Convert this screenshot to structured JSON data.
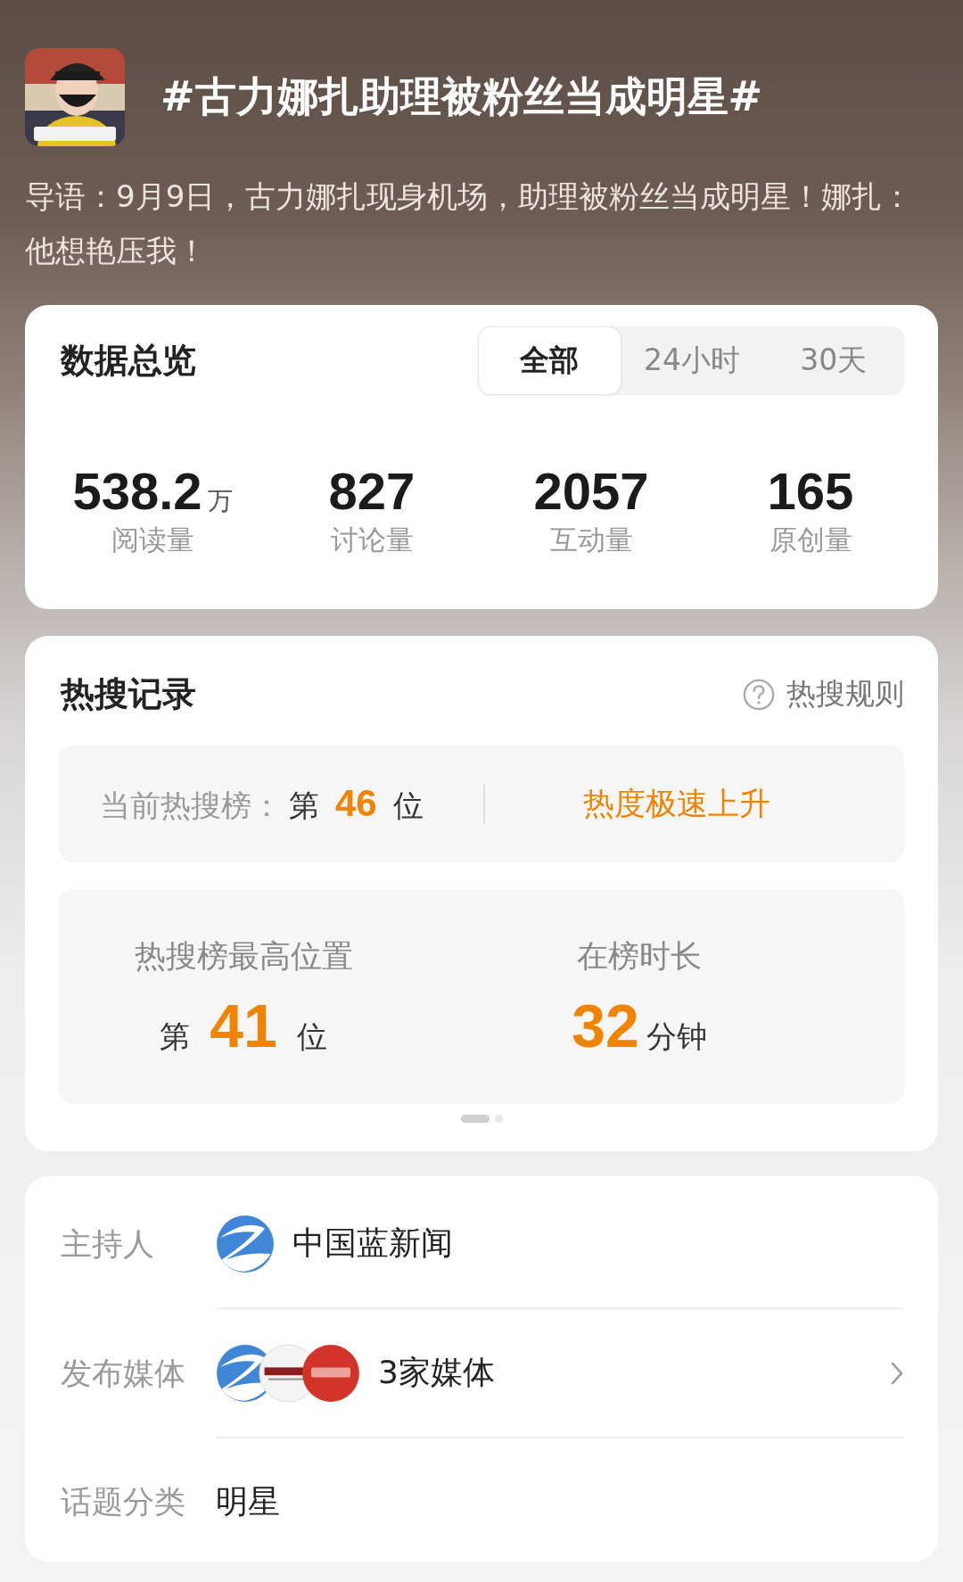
{
  "header": {
    "title": "#古力娜扎助理被粉丝当成明星#",
    "intro": "导语：9月9日，古力娜扎现身机场，助理被粉丝当成明星！娜扎：他想艳压我！"
  },
  "overview": {
    "title": "数据总览",
    "tabs": [
      {
        "label": "全部",
        "selected": true
      },
      {
        "label": "24小时",
        "selected": false
      },
      {
        "label": "30天",
        "selected": false
      }
    ],
    "stats": [
      {
        "value": "538.2",
        "unit": "万",
        "label": "阅读量"
      },
      {
        "value": "827",
        "label": "讨论量"
      },
      {
        "value": "2057",
        "label": "互动量"
      },
      {
        "value": "165",
        "label": "原创量"
      }
    ]
  },
  "hot_search": {
    "title": "热搜记录",
    "rules_link": "热搜规则",
    "current": {
      "label": "当前热搜榜：",
      "prefix": "第",
      "rank": "46",
      "suffix": "位",
      "trend": "热度极速上升"
    },
    "peak": {
      "label": "热搜榜最高位置",
      "prefix": "第",
      "rank": "41",
      "suffix": "位"
    },
    "duration": {
      "label": "在榜时长",
      "value": "32",
      "unit": "分钟"
    },
    "pager": [
      {
        "selected": true
      },
      {
        "selected": false
      }
    ]
  },
  "info": [
    {
      "kind": "host",
      "label": "主持人",
      "logos": [
        {
          "kind": "news"
        }
      ],
      "value": "中国蓝新闻"
    },
    {
      "kind": "media",
      "label": "发布媒体",
      "logos": [
        {
          "kind": "news"
        },
        {
          "kind": "paper"
        },
        {
          "kind": "seal"
        }
      ],
      "value": "3家媒体"
    },
    {
      "kind": "category",
      "label": "话题分类",
      "value": "明星"
    }
  ]
}
